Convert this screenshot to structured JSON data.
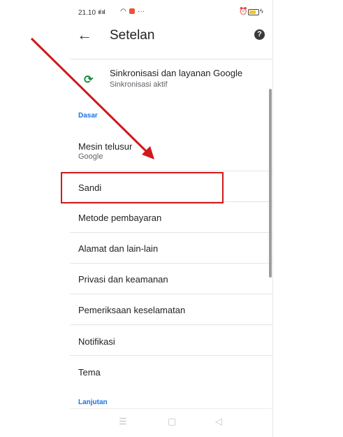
{
  "status_bar": {
    "time": "21.10",
    "signal": "ııl ııl",
    "dots": "···"
  },
  "header": {
    "title": "Setelan"
  },
  "sync": {
    "title": "Sinkronisasi dan layanan Google",
    "subtitle": "Sinkronisasi aktif"
  },
  "sections": {
    "basic": "Dasar",
    "advanced": "Lanjutan"
  },
  "items": [
    {
      "label": "Mesin telusur",
      "sub": "Google"
    },
    {
      "label": "Sandi"
    },
    {
      "label": "Metode pembayaran"
    },
    {
      "label": "Alamat dan lain-lain"
    },
    {
      "label": "Privasi dan keamanan"
    },
    {
      "label": "Pemeriksaan keselamatan"
    },
    {
      "label": "Notifikasi"
    },
    {
      "label": "Tema"
    }
  ],
  "annotation": {
    "highlight_color": "#d0191b",
    "highlighted_item": "Sandi"
  },
  "colors": {
    "accent": "#1a73e8",
    "sync_icon": "#1e8e3e"
  }
}
